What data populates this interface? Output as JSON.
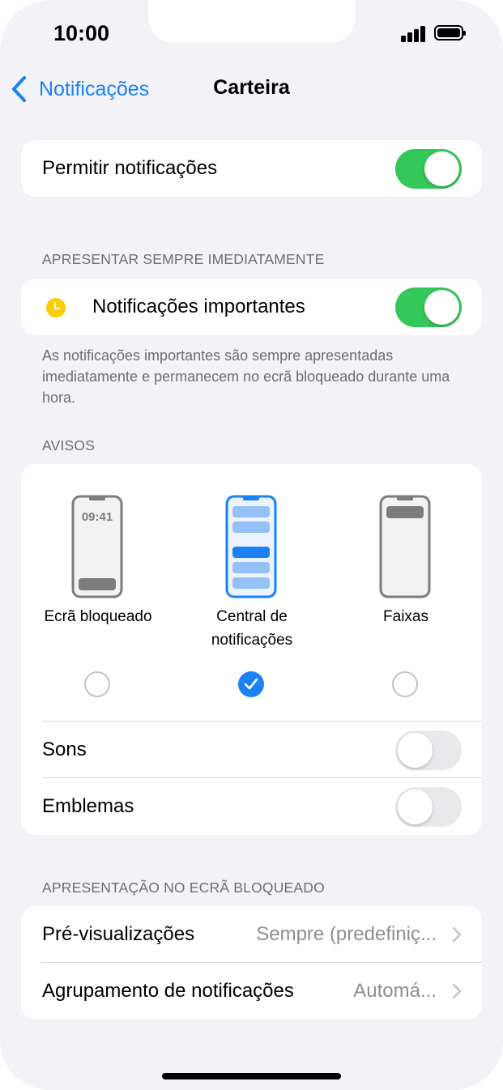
{
  "status_bar": {
    "time": "10:00"
  },
  "nav": {
    "back_label": "Notificações",
    "title": "Carteira"
  },
  "allow": {
    "label": "Permitir notificações",
    "on": true
  },
  "immediate": {
    "header": "APRESENTAR SEMPRE IMEDIATAMENTE",
    "label": "Notificações importantes",
    "on": true,
    "footnote": "As notificações importantes são sempre apresentadas imediatamente e permanecem no ecrã bloqueado durante uma hora."
  },
  "alerts": {
    "header": "AVISOS",
    "options": [
      {
        "caption": "Ecrã bloqueado",
        "selected": false,
        "clock": "09:41"
      },
      {
        "caption": "Central de\nnotificações",
        "selected": true
      },
      {
        "caption": "Faixas",
        "selected": false
      }
    ],
    "sounds": {
      "label": "Sons",
      "on": false
    },
    "badges": {
      "label": "Emblemas",
      "on": false
    }
  },
  "lock_screen": {
    "header": "APRESENTAÇÃO NO ECRÃ BLOQUEADO",
    "previews": {
      "label": "Pré-visualizações",
      "value": "Sempre (predefiniç..."
    },
    "grouping": {
      "label": "Agrupamento de notificações",
      "value": "Automá..."
    }
  },
  "colors": {
    "accent": "#1a82f5",
    "toggle_on": "#34c759",
    "toggle_off": "#e9e9eb",
    "important_icon": "#ffcc00",
    "secondary_text": "#6d6d72"
  }
}
